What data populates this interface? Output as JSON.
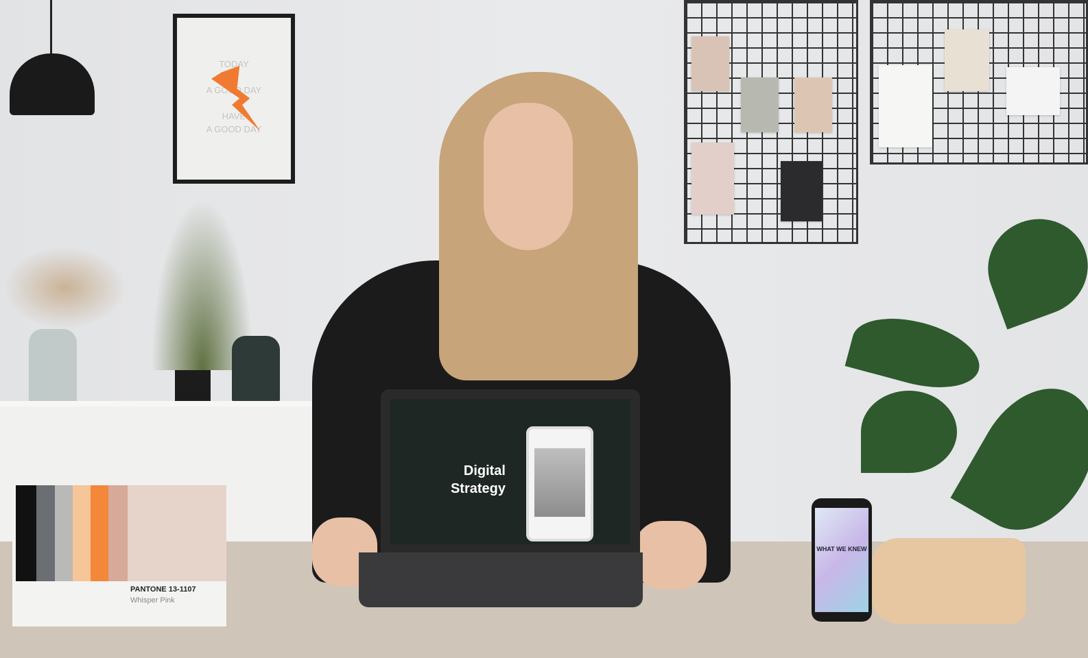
{
  "poster": {
    "lines": [
      "TODAY",
      "A GOOD DAY",
      "HAVE",
      "A GOOD DAY"
    ]
  },
  "laptop": {
    "screen_title_line1": "Digital",
    "screen_title_line2": "Strategy"
  },
  "phone": {
    "screen_text": "WHAT WE KNEW"
  },
  "swatch_card": {
    "label": "PANTONE 13-1107",
    "name": "Whisper Pink"
  },
  "colors": {
    "orange": "#f07a32",
    "wall": "#e4e5e7",
    "desk": "#cfc5b8"
  }
}
